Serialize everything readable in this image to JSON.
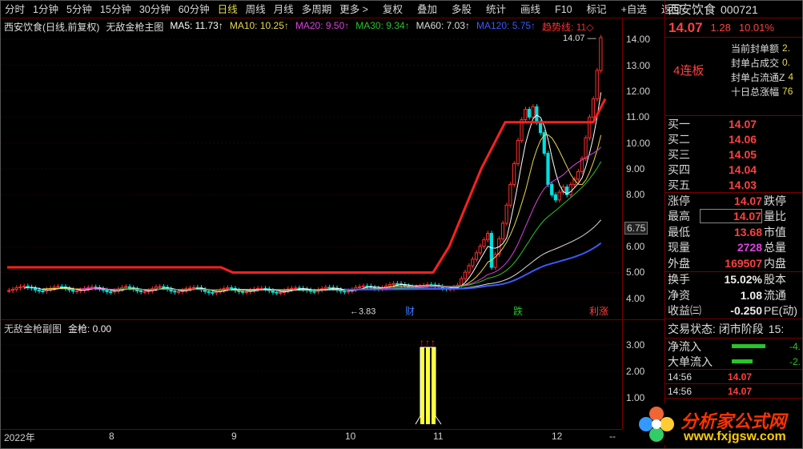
{
  "toolbar": {
    "items": [
      "分时",
      "1分钟",
      "5分钟",
      "15分钟",
      "30分钟",
      "60分钟",
      "日线",
      "周线",
      "月线",
      "多周期",
      "更多 >"
    ],
    "active_index": 6,
    "right_items": [
      "复权",
      "叠加",
      "多股",
      "统计",
      "画线",
      "F10",
      "标记",
      "+自选",
      "返回"
    ]
  },
  "main_header": {
    "stock": "西安饮食(日线,前复权)",
    "indicator": "无敌金枪主图",
    "ma": [
      {
        "t": "MA5: 11.73↑",
        "c": "#ffffff"
      },
      {
        "t": "MA10: 10.25↑",
        "c": "#e8d94a"
      },
      {
        "t": "MA20: 9.50↑",
        "c": "#e040e0"
      },
      {
        "t": "MA30: 9.34↑",
        "c": "#29c429"
      },
      {
        "t": "MA60: 7.03↑",
        "c": "#dddddd"
      },
      {
        "t": "MA120: 5.75↑",
        "c": "#3a5aff"
      },
      {
        "t": "趋势线: 11◇",
        "c": "#ff3030"
      }
    ]
  },
  "price_ticks": [
    "14.00",
    "13.00",
    "12.00",
    "11.00",
    "10.00",
    "9.00",
    "8.00",
    "6.75",
    "6.00",
    "5.00",
    "4.00"
  ],
  "chart_data": {
    "type": "candlestick",
    "price_range": [
      3.5,
      14.5
    ],
    "high_label": "14.07",
    "low_label": "3.83",
    "event_labels": [
      {
        "t": "财",
        "c": "#3a7aff"
      },
      {
        "t": "跌",
        "c": "#29c429"
      },
      {
        "t": "利涨",
        "c": "#ff4040"
      }
    ]
  },
  "sub_header": {
    "indicator": "无敌金枪副图",
    "value": "金枪: 0.00"
  },
  "sub_ticks": [
    "3.00",
    "2.00",
    "1.00"
  ],
  "dates": [
    "2022年",
    "8",
    "9",
    "10",
    "11",
    "12",
    "--"
  ],
  "side": {
    "name": "西安饮食",
    "code": "000721",
    "price": "14.07",
    "change": "1.28",
    "pct": "10.01%",
    "badge": "4连板",
    "seal": [
      {
        "l": "当前封单额",
        "v": "2."
      },
      {
        "l": "封单占成交",
        "v": "0."
      },
      {
        "l": "封单占流通Z",
        "v": "4"
      },
      {
        "l": "十日总涨幅",
        "v": "76"
      }
    ],
    "bids": [
      {
        "l": "买一",
        "v": "14.07"
      },
      {
        "l": "买二",
        "v": "14.06"
      },
      {
        "l": "买三",
        "v": "14.05"
      },
      {
        "l": "买四",
        "v": "14.04"
      },
      {
        "l": "买五",
        "v": "14.03"
      }
    ],
    "stats": [
      {
        "l": "涨停",
        "v": "14.07",
        "l2": "跌停",
        "c": "red"
      },
      {
        "l": "最高",
        "v": "14.07",
        "l2": "量比",
        "c": "red"
      },
      {
        "l": "最低",
        "v": "13.68",
        "l2": "市值",
        "c": "red"
      },
      {
        "l": "现量",
        "v": "2728",
        "l2": "总量",
        "c": "pur"
      },
      {
        "l": "外盘",
        "v": "169507",
        "l2": "内盘",
        "c": "red"
      }
    ],
    "stats2": [
      {
        "l": "换手",
        "v": "15.02%",
        "l2": "股本",
        "c": "wht"
      },
      {
        "l": "净资",
        "v": "1.08",
        "l2": "流通",
        "c": "wht"
      },
      {
        "l": "收益㈢",
        "v": "-0.250",
        "l2": "PE(动)",
        "c": "wht"
      }
    ],
    "trade_state": "交易状态: 闭市阶段",
    "trade_time": "15:",
    "flows": [
      {
        "l": "净流入",
        "v": "-4."
      },
      {
        "l": "大单流入",
        "v": "-2."
      }
    ],
    "ticks": [
      {
        "t": "14:56",
        "v": "14.07"
      },
      {
        "t": "14:56",
        "v": "14.07"
      }
    ]
  },
  "watermark": {
    "title": "分析家公式网",
    "url": "www.fxjgsw.com"
  }
}
